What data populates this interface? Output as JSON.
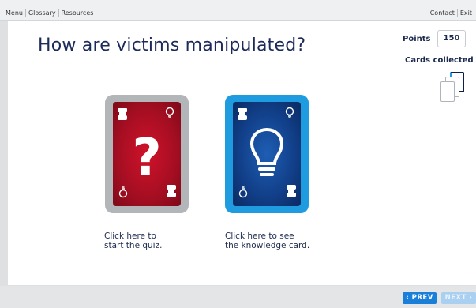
{
  "topbar": {
    "left_links": [
      "Menu",
      "Glossary",
      "Resources"
    ],
    "right_links": [
      "Contact",
      "Exit"
    ]
  },
  "main": {
    "title": "How are victims manipulated?",
    "points_label": "Points",
    "points_value": "150",
    "cards_collected_label": "Cards collected"
  },
  "cards": {
    "quiz": {
      "caption_line1": "Click here to",
      "caption_line2": "start the quiz.",
      "color": "#c8102e",
      "symbol": "?"
    },
    "knowledge": {
      "caption_line1": "Click here to see",
      "caption_line2": "the knowledge card.",
      "color": "#1a4a9a"
    }
  },
  "footer": {
    "prev_label": "‹ PREV",
    "next_label": "NEXT ›"
  },
  "colors": {
    "accent": "#1a7fd8",
    "title": "#1c2a5a",
    "quiz_frame": "#b3b6b9",
    "knowledge_frame": "#1f9be0"
  }
}
